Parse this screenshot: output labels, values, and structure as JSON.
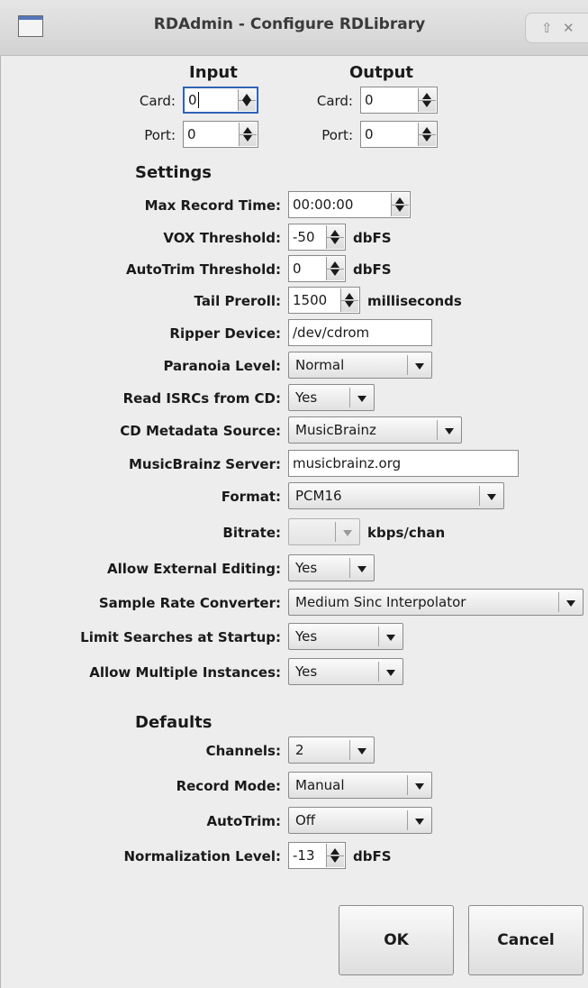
{
  "window": {
    "title": "RDAdmin - Configure RDLibrary",
    "icon": "window-icon",
    "controls": {
      "maximize": "⇧",
      "close": "✕"
    }
  },
  "input": {
    "heading": "Input",
    "card_label": "Card:",
    "card_value": "0",
    "port_label": "Port:",
    "port_value": "0"
  },
  "output": {
    "heading": "Output",
    "card_label": "Card:",
    "card_value": "0",
    "port_label": "Port:",
    "port_value": "0"
  },
  "settings": {
    "heading": "Settings",
    "max_record_time": {
      "label": "Max Record Time:",
      "value": "00:00:00"
    },
    "vox_threshold": {
      "label": "VOX Threshold:",
      "value": "-50",
      "unit": "dbFS"
    },
    "autotrim_threshold": {
      "label": "AutoTrim Threshold:",
      "value": "0",
      "unit": "dbFS"
    },
    "tail_preroll": {
      "label": "Tail Preroll:",
      "value": "1500",
      "unit": "milliseconds"
    },
    "ripper_device": {
      "label": "Ripper Device:",
      "value": "/dev/cdrom"
    },
    "paranoia_level": {
      "label": "Paranoia Level:",
      "value": "Normal"
    },
    "read_isrcs": {
      "label": "Read ISRCs from CD:",
      "value": "Yes"
    },
    "cd_metadata_source": {
      "label": "CD Metadata Source:",
      "value": "MusicBrainz"
    },
    "musicbrainz_server": {
      "label": "MusicBrainz Server:",
      "value": "musicbrainz.org"
    },
    "format": {
      "label": "Format:",
      "value": "PCM16"
    },
    "bitrate": {
      "label": "Bitrate:",
      "value": "",
      "unit": "kbps/chan"
    },
    "allow_external_editing": {
      "label": "Allow External Editing:",
      "value": "Yes"
    },
    "sample_rate_converter": {
      "label": "Sample Rate Converter:",
      "value": "Medium Sinc Interpolator"
    },
    "limit_searches": {
      "label": "Limit Searches at Startup:",
      "value": "Yes"
    },
    "allow_multiple_instances": {
      "label": "Allow Multiple Instances:",
      "value": "Yes"
    }
  },
  "defaults": {
    "heading": "Defaults",
    "channels": {
      "label": "Channels:",
      "value": "2"
    },
    "record_mode": {
      "label": "Record Mode:",
      "value": "Manual"
    },
    "autotrim": {
      "label": "AutoTrim:",
      "value": "Off"
    },
    "normalization_level": {
      "label": "Normalization Level:",
      "value": "-13",
      "unit": "dbFS"
    }
  },
  "buttons": {
    "ok": "OK",
    "cancel": "Cancel"
  }
}
